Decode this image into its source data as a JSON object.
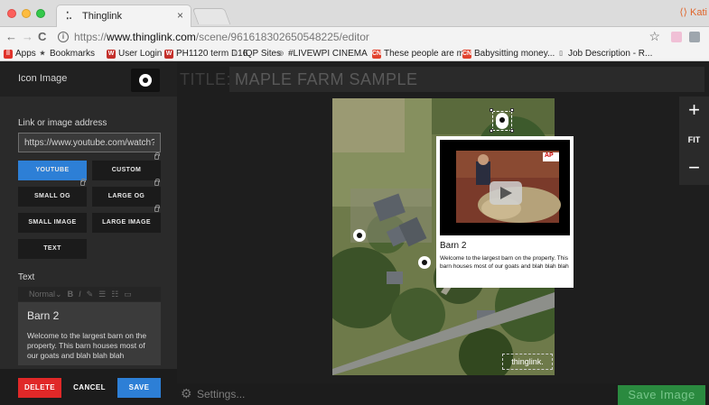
{
  "browser": {
    "tab_title": "Thinglink",
    "tab_favicon": "⁚.",
    "profile_name": "Kati",
    "url_prefix": "https://",
    "url_host": "www.thinglink.com",
    "url_path": "/scene/961618302650548225/editor",
    "bookmarks": [
      {
        "label": "Apps",
        "icon": "apps-icon",
        "color": "#e0322a"
      },
      {
        "label": "Bookmarks",
        "icon": "star-icon",
        "color": "#444444"
      },
      {
        "label": "User Login",
        "icon": "w-icon",
        "color": "#c4302b"
      },
      {
        "label": "PH1120 term D16",
        "icon": "w-icon",
        "color": "#c4302b"
      },
      {
        "label": "IQP Sites",
        "icon": "page-icon",
        "color": "#888888"
      },
      {
        "label": "#LIVEWPI CINEMA",
        "icon": "globe-icon",
        "color": "#777777"
      },
      {
        "label": "These people are m...",
        "icon": "news-icon",
        "color": "#e2432e"
      },
      {
        "label": "Babysitting money...",
        "icon": "news-icon",
        "color": "#e2432e"
      },
      {
        "label": "Job Description - R...",
        "icon": "page-icon",
        "color": "#888888"
      }
    ]
  },
  "panel": {
    "icon_image_label": "Icon Image",
    "link_label": "Link or image address",
    "link_value": "https://www.youtube.com/watch?",
    "type_buttons": [
      {
        "label": "YOUTUBE",
        "active": true,
        "locked": false
      },
      {
        "label": "CUSTOM",
        "active": false,
        "locked": true
      },
      {
        "label": "SMALL OG",
        "active": false,
        "locked": true
      },
      {
        "label": "LARGE OG",
        "active": false,
        "locked": true
      },
      {
        "label": "SMALL IMAGE",
        "active": false,
        "locked": false
      },
      {
        "label": "LARGE IMAGE",
        "active": false,
        "locked": true
      },
      {
        "label": "TEXT",
        "active": false,
        "locked": false
      }
    ],
    "text_label": "Text",
    "toolbar_style": "Normal",
    "text_title": "Barn 2",
    "text_body": "Welcome to the largest barn on the property. This barn houses most of our goats and blah blah blah",
    "delete_label": "DELETE",
    "cancel_label": "CANCEL",
    "save_label": "SAVE"
  },
  "editor": {
    "title_label": "TITLE:",
    "title_value": "MAPLE FARM SAMPLE",
    "zoom_in": "+",
    "zoom_fit": "FIT",
    "zoom_out": "−",
    "tooltip_title": "Barn 2",
    "tooltip_body": "Welcome to the largest barn on the property. This barn houses most of our goats and blah blah blah",
    "video_badge": "AP",
    "watermark": "thinglink.",
    "settings_label": "Settings...",
    "save_image_label": "Save Image"
  },
  "colors": {
    "accent_blue": "#2d7fd6",
    "delete_red": "#e02828",
    "save_image_green": "#2a8a3f"
  }
}
